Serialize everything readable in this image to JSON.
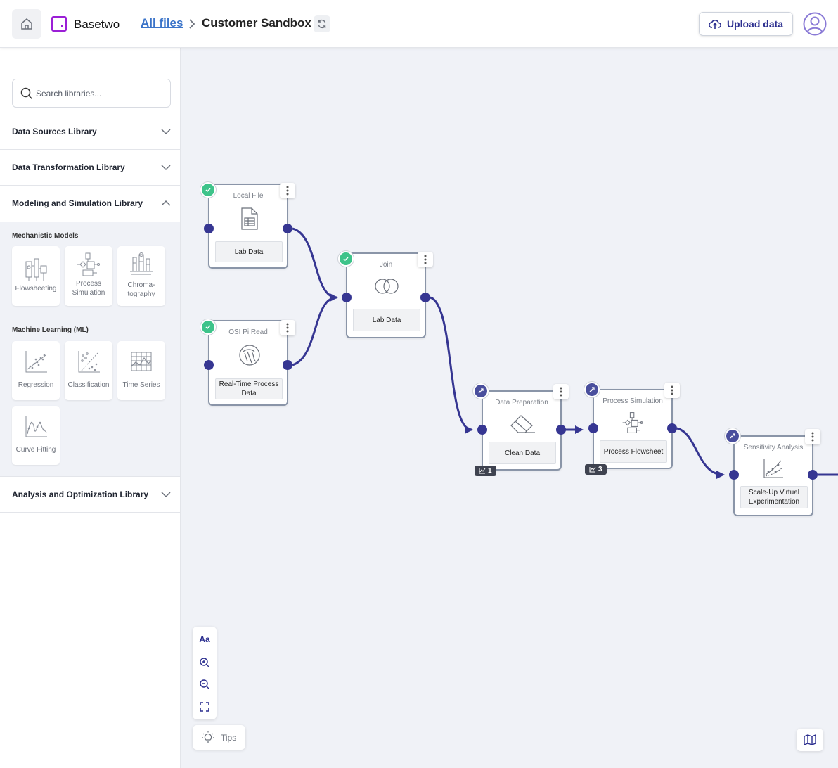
{
  "header": {
    "brand": "Basetwo",
    "breadcrumb_root": "All files",
    "breadcrumb_current": "Customer Sandbox",
    "upload_label": "Upload data"
  },
  "sidebar": {
    "search_placeholder": "Search libraries...",
    "libraries": [
      {
        "label": "Data Sources Library",
        "expanded": false
      },
      {
        "label": "Data Transformation Library",
        "expanded": false
      },
      {
        "label": "Modeling and Simulation Library",
        "expanded": true
      },
      {
        "label": "Analysis and Optimization Library",
        "expanded": false
      }
    ],
    "groups": [
      {
        "label": "Mechanistic Models",
        "tiles": [
          "Flowsheeting",
          "Process Simulation",
          "Chroma-tography"
        ]
      },
      {
        "label": "Machine Learning (ML)",
        "tiles": [
          "Regression",
          "Classification",
          "Time Series",
          "Curve Fitting"
        ]
      }
    ]
  },
  "nodes": [
    {
      "type": "Local File",
      "label": "Lab Data",
      "status": "complete"
    },
    {
      "type": "OSI Pi Read",
      "label": "Real-Time Process Data",
      "status": "complete"
    },
    {
      "type": "Join",
      "label": "Lab Data",
      "status": "complete"
    },
    {
      "type": "Data Preparation",
      "label": "Clean Data",
      "status": "running",
      "badge": "1"
    },
    {
      "type": "Process Simulation",
      "label": "Process Flowsheet",
      "status": "running",
      "badge": "3"
    },
    {
      "type": "Sensitivity Analysis",
      "label": "Scale-Up Virtual Experimentation",
      "status": "running"
    }
  ],
  "toolbar": {
    "font_label": "Aa"
  },
  "tips_label": "Tips",
  "colors": {
    "accent": "#363692",
    "success": "#3ec38a",
    "brand": "#9b1fd6",
    "link": "#3b74c9"
  }
}
